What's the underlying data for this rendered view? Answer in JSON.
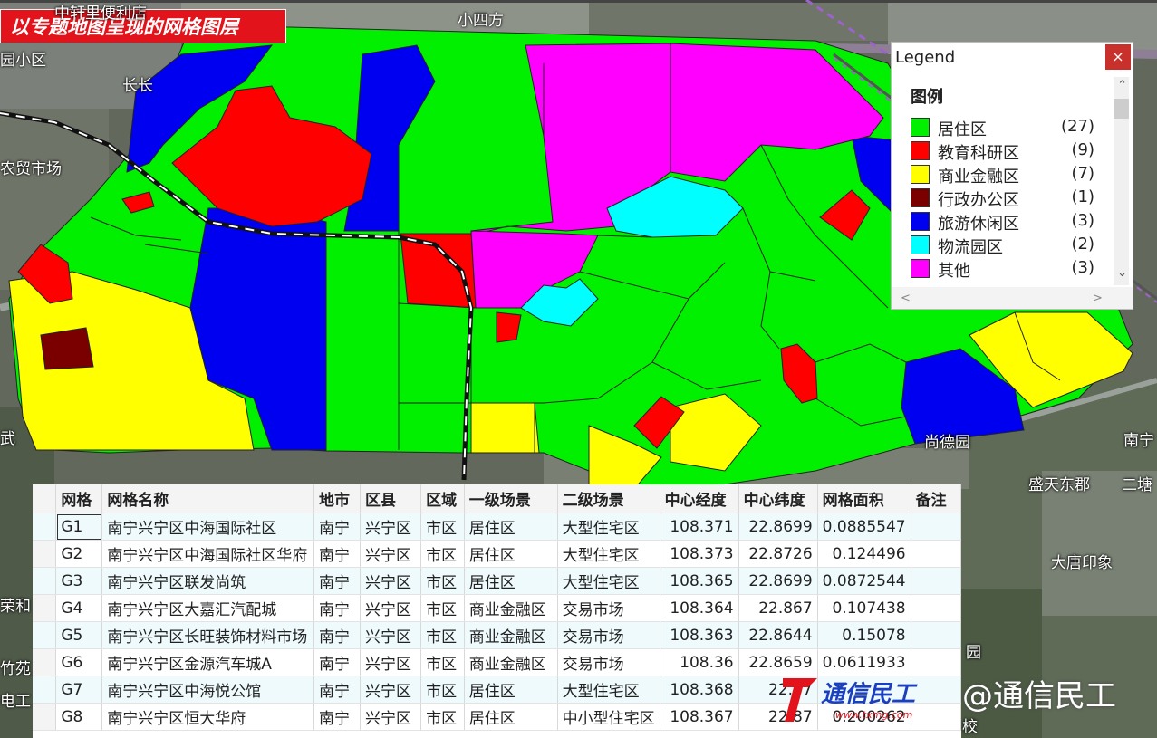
{
  "banner": "以专题地图呈现的网格图层",
  "map_labels": {
    "top_road": "中轩里便利店",
    "place_top": "小四方",
    "left_1": "园小区",
    "left_2": "长长",
    "left_3": "农贸市场",
    "left_4": "武",
    "right_1": "南宁",
    "right_2": "盛天东郡",
    "right_3": "大唐印象",
    "right_4": "二塘",
    "right_5": "园",
    "right_6": "校",
    "right_7": "尚德园",
    "left_5": "荣和",
    "left_6": "竹苑",
    "left_7": "电工"
  },
  "legend": {
    "window_title": "Legend",
    "close_label": "×",
    "heading": "图例",
    "items": [
      {
        "label": "居住区",
        "count": "(27)",
        "color": "#00f000"
      },
      {
        "label": "教育科研区",
        "count": "(9)",
        "color": "#ff0000"
      },
      {
        "label": "商业金融区",
        "count": "(7)",
        "color": "#ffff00"
      },
      {
        "label": "行政办公区",
        "count": "(1)",
        "color": "#7a0000"
      },
      {
        "label": "旅游休闲区",
        "count": "(3)",
        "color": "#0000f0"
      },
      {
        "label": "物流园区",
        "count": "(2)",
        "color": "#00ffff"
      },
      {
        "label": "其他",
        "count": "(3)",
        "color": "#ff00ff"
      }
    ]
  },
  "table": {
    "columns": [
      "网格",
      "网格名称",
      "地市",
      "区县",
      "区域",
      "一级场景",
      "二级场景",
      "中心经度",
      "中心纬度",
      "网格面积",
      "备注"
    ],
    "rows": [
      [
        "G1",
        "南宁兴宁区中海国际社区",
        "南宁",
        "兴宁区",
        "市区",
        "居住区",
        "大型住宅区",
        "108.371",
        "22.8699",
        "0.0885547",
        ""
      ],
      [
        "G2",
        "南宁兴宁区中海国际社区华府",
        "南宁",
        "兴宁区",
        "市区",
        "居住区",
        "大型住宅区",
        "108.373",
        "22.8726",
        "0.124496",
        ""
      ],
      [
        "G3",
        "南宁兴宁区联发尚筑",
        "南宁",
        "兴宁区",
        "市区",
        "居住区",
        "大型住宅区",
        "108.365",
        "22.8699",
        "0.0872544",
        ""
      ],
      [
        "G4",
        "南宁兴宁区大嘉汇汽配城",
        "南宁",
        "兴宁区",
        "市区",
        "商业金融区",
        "交易市场",
        "108.364",
        "22.867",
        "0.107438",
        ""
      ],
      [
        "G5",
        "南宁兴宁区长旺装饰材料市场",
        "南宁",
        "兴宁区",
        "市区",
        "商业金融区",
        "交易市场",
        "108.363",
        "22.8644",
        "0.15078",
        ""
      ],
      [
        "G6",
        "南宁兴宁区金源汽车城A",
        "南宁",
        "兴宁区",
        "市区",
        "商业金融区",
        "交易市场",
        "108.36",
        "22.8659",
        "0.0611933",
        ""
      ],
      [
        "G7",
        "南宁兴宁区中海悦公馆",
        "南宁",
        "兴宁区",
        "市区",
        "居住区",
        "大型住宅区",
        "108.368",
        "22.87",
        "",
        ""
      ],
      [
        "G8",
        "南宁兴宁区恒大华府",
        "南宁",
        "兴宁区",
        "市区",
        "居住区",
        "中小型住宅区",
        "108.367",
        "22.87",
        "0.200262",
        ""
      ]
    ]
  },
  "watermark": {
    "logo_text": "通信民工",
    "url": "www.txmg.com",
    "text": "@通信民工"
  }
}
